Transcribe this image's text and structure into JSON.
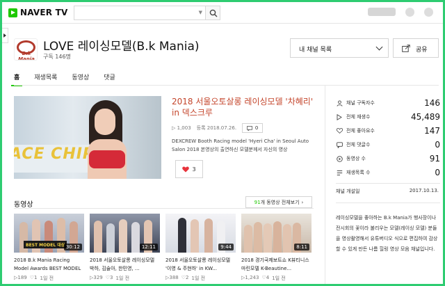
{
  "header": {
    "logo_text": "NAVER TV",
    "search": {
      "placeholder": ""
    }
  },
  "channel": {
    "logo_text": "B.k Mania",
    "title": "LOVE 레이싱모델(B.k Mania)",
    "subscribers_label": "구독 146명",
    "dropdown_label": "내 채널 목록",
    "share_label": "공유"
  },
  "tabs": [
    "홈",
    "재생목록",
    "동영상",
    "댓글"
  ],
  "featured": {
    "banner_text": "ACE CHIP",
    "title": "2018 서울오토살롱 레이싱모델 '차혜리' in 덱스크루",
    "plays": "1,003",
    "date": "등록 2018.07.26.",
    "comments": "0",
    "description": "DEXCREW Booth Racing model 'Hyeri Cha' in Seoul Auto Salon 2018 본영상의 출연하신 모델분께서 자신의 영상",
    "likes": "3"
  },
  "stats": {
    "items": [
      {
        "icon": "person-icon",
        "label": "채널 구독자수",
        "value": "146"
      },
      {
        "icon": "play-icon",
        "label": "전체 재생수",
        "value": "45,489"
      },
      {
        "icon": "heart-icon",
        "label": "전체 좋아요수",
        "value": "147"
      },
      {
        "icon": "comment-icon",
        "label": "전체 댓글수",
        "value": "0"
      },
      {
        "icon": "video-icon",
        "label": "동영상 수",
        "value": "91"
      },
      {
        "icon": "playlist-icon",
        "label": "재생목록 수",
        "value": "0"
      }
    ],
    "opened_label": "채널 개설일",
    "opened_date": "2017.10.13.",
    "about": "레이싱모델을 좋아하는 B.k Mania가 행사장이나 전시회의 꽃이라 불리우는 모델(레이싱 모델) 분들을 영상촬영해서 유튜버디오 식으로 편집하여 감상할 수 있게 만든 나름 힐링 영상 모음 채널입니다."
  },
  "videos": {
    "section_title": "동영상",
    "all_button_count": "91",
    "all_button_label": "개 동영상 전체보기",
    "items": [
      {
        "duration": "30:12",
        "badge": "BEST MODEL 대상",
        "title": "2018 B.k Mania Racing Model Awards BEST MODEL 대상",
        "plays": "189",
        "comments": "1",
        "date": "1일 전"
      },
      {
        "duration": "12:11",
        "badge": "",
        "title": "2018 서울오토살롱 레이싱모델 박하, 김술아, 한민영, ...",
        "plays": "329",
        "comments": "3",
        "date": "1일 전"
      },
      {
        "duration": "9:44",
        "badge": "",
        "title": "2018 서울오토살롱 레이싱모델 '이영 & 주현하' in KW...",
        "plays": "388",
        "comments": "2",
        "date": "1일 전"
      },
      {
        "duration": "8:11",
        "badge": "",
        "title": "2018 경기국제보트쇼 K뷰티니스 마린모델 K-Beautine...",
        "plays": "1,243",
        "comments": "4",
        "date": "1일 전"
      }
    ]
  }
}
